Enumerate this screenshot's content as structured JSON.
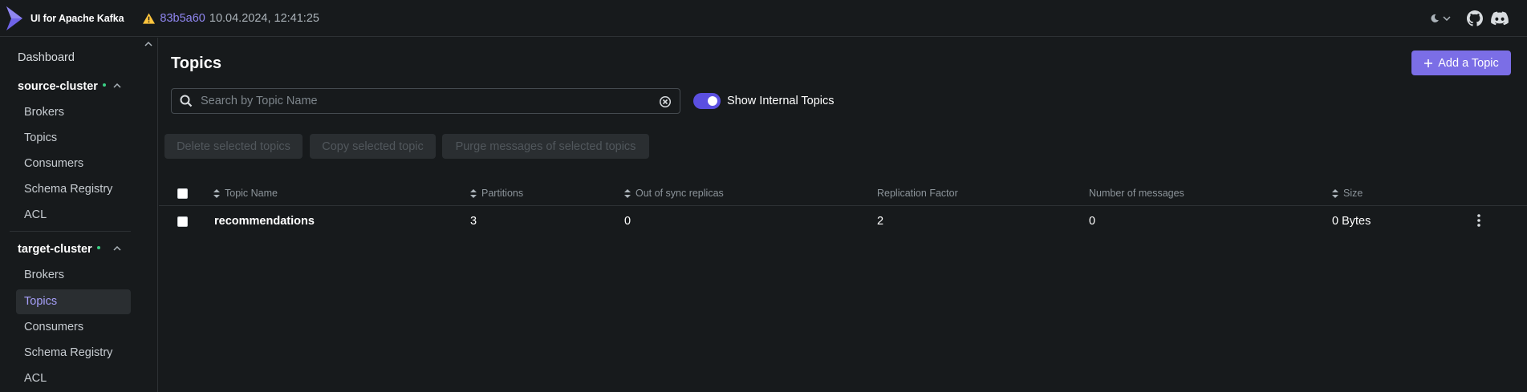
{
  "header": {
    "app_title": "UI for Apache Kafka",
    "commit": "83b5a60",
    "build_date": "10.04.2024, 12:41:25"
  },
  "sidebar": {
    "dashboard": "Dashboard",
    "clusters": [
      {
        "name": "source-cluster",
        "status": "online",
        "items": [
          "Brokers",
          "Topics",
          "Consumers",
          "Schema Registry",
          "ACL"
        ]
      },
      {
        "name": "target-cluster",
        "status": "online",
        "items": [
          "Brokers",
          "Topics",
          "Consumers",
          "Schema Registry",
          "ACL"
        ],
        "active_item": "Topics"
      }
    ]
  },
  "main": {
    "title": "Topics",
    "add_button": "Add a Topic",
    "search_placeholder": "Search by Topic Name",
    "search_value": "",
    "show_internal_label": "Show Internal Topics",
    "show_internal_checked": true,
    "bulk_actions": [
      "Delete selected topics",
      "Copy selected topic",
      "Purge messages of selected topics"
    ],
    "table": {
      "columns": [
        "Topic Name",
        "Partitions",
        "Out of sync replicas",
        "Replication Factor",
        "Number of messages",
        "Size"
      ],
      "rows": [
        {
          "name": "recommendations",
          "partitions": "3",
          "out_of_sync": "0",
          "replication_factor": "2",
          "messages": "0",
          "size": "0 Bytes"
        }
      ]
    }
  },
  "colors": {
    "background": "#171a1c",
    "accent": "#7b6ee6",
    "active_text": "#a69ff9",
    "status_online": "#3ad085",
    "warning": "#ffc53d"
  }
}
